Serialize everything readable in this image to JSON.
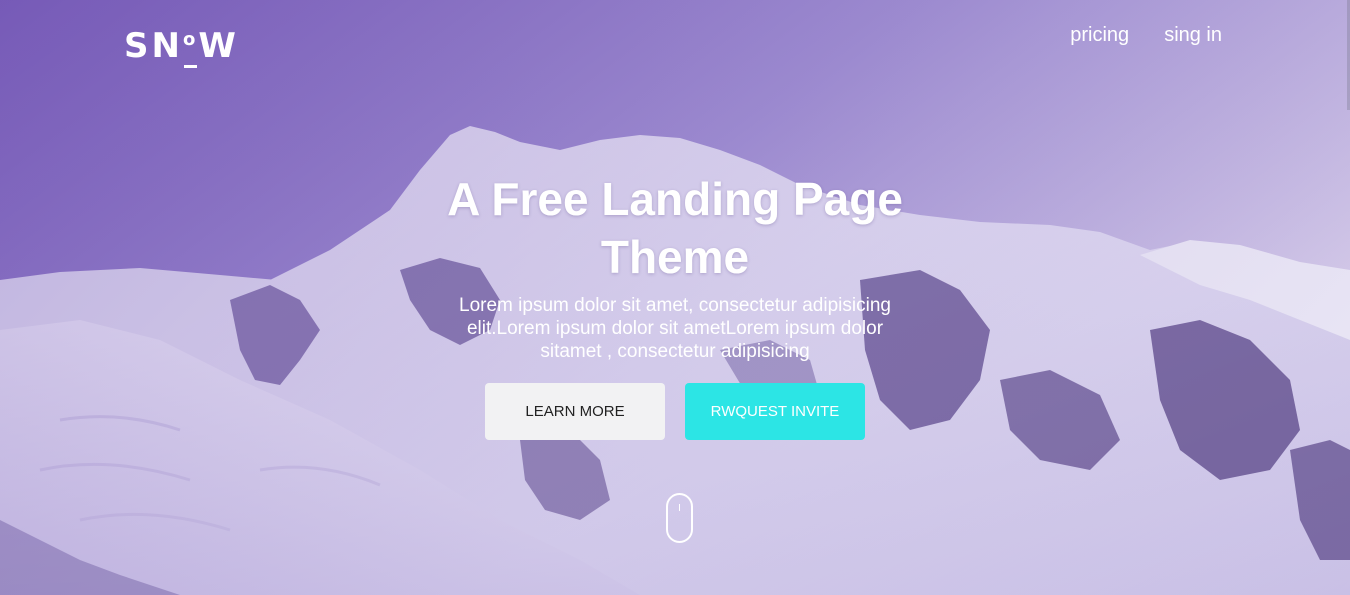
{
  "brand": {
    "logo_text_start": "SN",
    "logo_text_o": "o",
    "logo_text_end": "W"
  },
  "nav": {
    "items": [
      {
        "label": "pricing"
      },
      {
        "label": "sing in"
      }
    ]
  },
  "hero": {
    "headline": "A Free Landing Page Theme",
    "subtext": "Lorem ipsum dolor sit amet, consectetur adipisicing elit.Lorem ipsum dolor sit ametLorem ipsum dolor sitamet , consectetur adipisicing",
    "learn_more_label": "LEARN MORE",
    "request_invite_label": "RWQUEST INVITE"
  },
  "colors": {
    "accent": "#2ce5e5",
    "overlay": "#7a5fb8",
    "light_button": "#f2f2f3"
  },
  "icons": {
    "scroll": "mouse-scroll-icon"
  }
}
